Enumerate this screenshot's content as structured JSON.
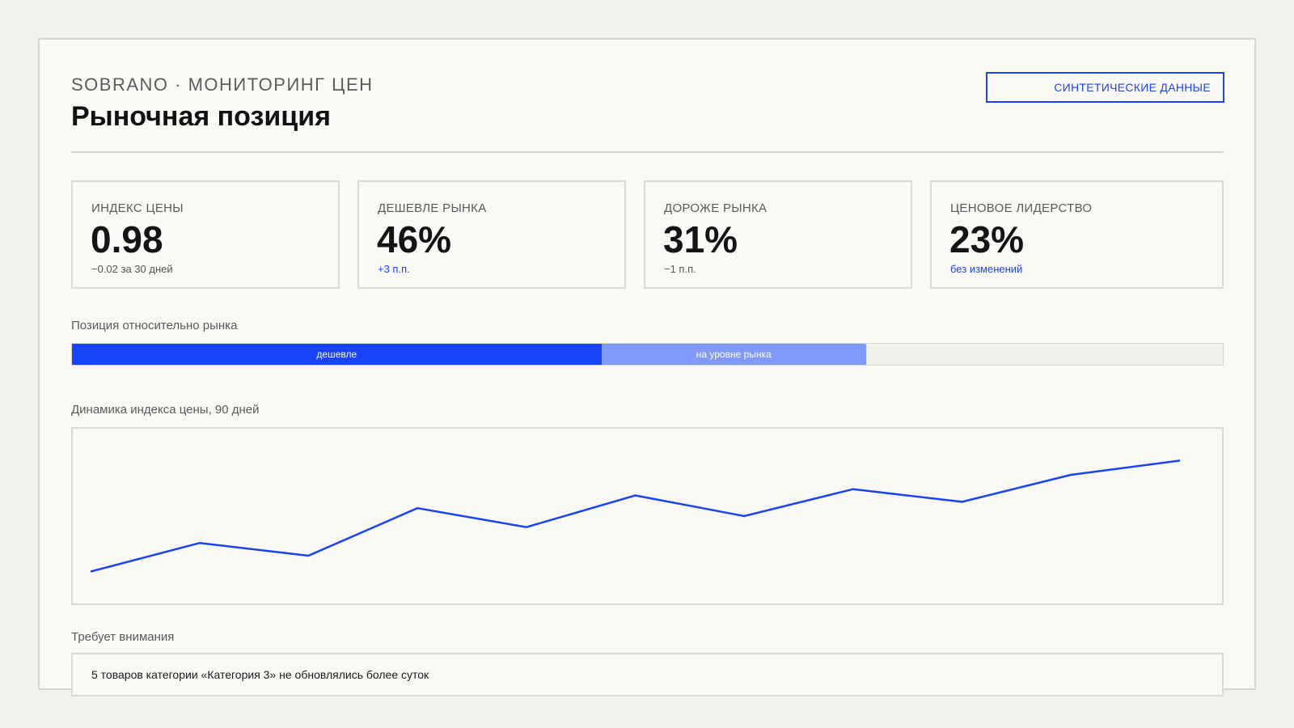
{
  "header": {
    "eyebrow": "SOBRANO · МОНИТОРИНГ ЦЕН",
    "title": "Рыночная позиция",
    "badge": "СИНТЕТИЧЕСКИЕ ДАННЫЕ"
  },
  "kpis": [
    {
      "label": "ИНДЕКС ЦЕНЫ",
      "value": "0.98",
      "delta": "−0.02 за 30 дней"
    },
    {
      "label": "ДЕШЕВЛЕ РЫНКА",
      "value": "46%",
      "delta": "+3 п.п."
    },
    {
      "label": "ДОРОЖЕ РЫНКА",
      "value": "31%",
      "delta": "−1 п.п."
    },
    {
      "label": "ЦЕНОВОЕ ЛИДЕРСТВО",
      "value": "23%",
      "delta": "без изменений"
    }
  ],
  "position": {
    "title": "Позиция относительно рынка",
    "segments": [
      {
        "label": "дешевле",
        "share": 46,
        "color": "#1a44f7"
      },
      {
        "label": "на уровне рынка",
        "share": 23,
        "color": "#8099fb"
      },
      {
        "label": "",
        "share": 31,
        "color": "#f1efea"
      }
    ]
  },
  "chart": {
    "title": "Динамика индекса цены, 90 дней"
  },
  "chart_data": {
    "type": "line",
    "x": [
      1,
      2,
      3,
      4,
      5,
      6,
      7,
      8,
      9,
      10,
      11
    ],
    "series": [
      {
        "values": [
          0.915,
          0.933,
          0.925,
          0.955,
          0.943,
          0.963,
          0.95,
          0.967,
          0.959,
          0.976,
          0.985
        ]
      }
    ],
    "ylim": [
      0.9,
      1.0
    ],
    "color": "#1a44f2",
    "grid": false
  },
  "attention": {
    "title": "Требует внимания",
    "message": "5 товаров категории «Категория 3» не обновлялись более суток"
  },
  "colors": {
    "accent": "#1a44f2",
    "background": "#f3f1ec",
    "card": "#faf9f6"
  }
}
